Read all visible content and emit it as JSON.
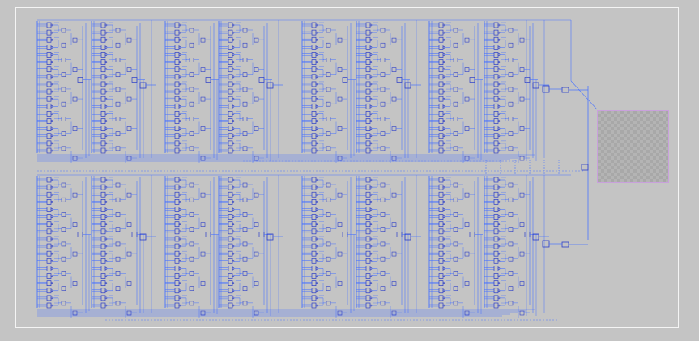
{
  "canvas": {
    "background": "#c4c4c4",
    "frame_color": "#f4f4f4",
    "wire_color": "#4a73ff",
    "symbol_color": "#2a3cc8",
    "placeholder_border": "#c9a0dc"
  },
  "schematic": {
    "banks": 2,
    "columns_per_bank": 8,
    "gates_per_column": 18,
    "connector_stubs": 6
  }
}
